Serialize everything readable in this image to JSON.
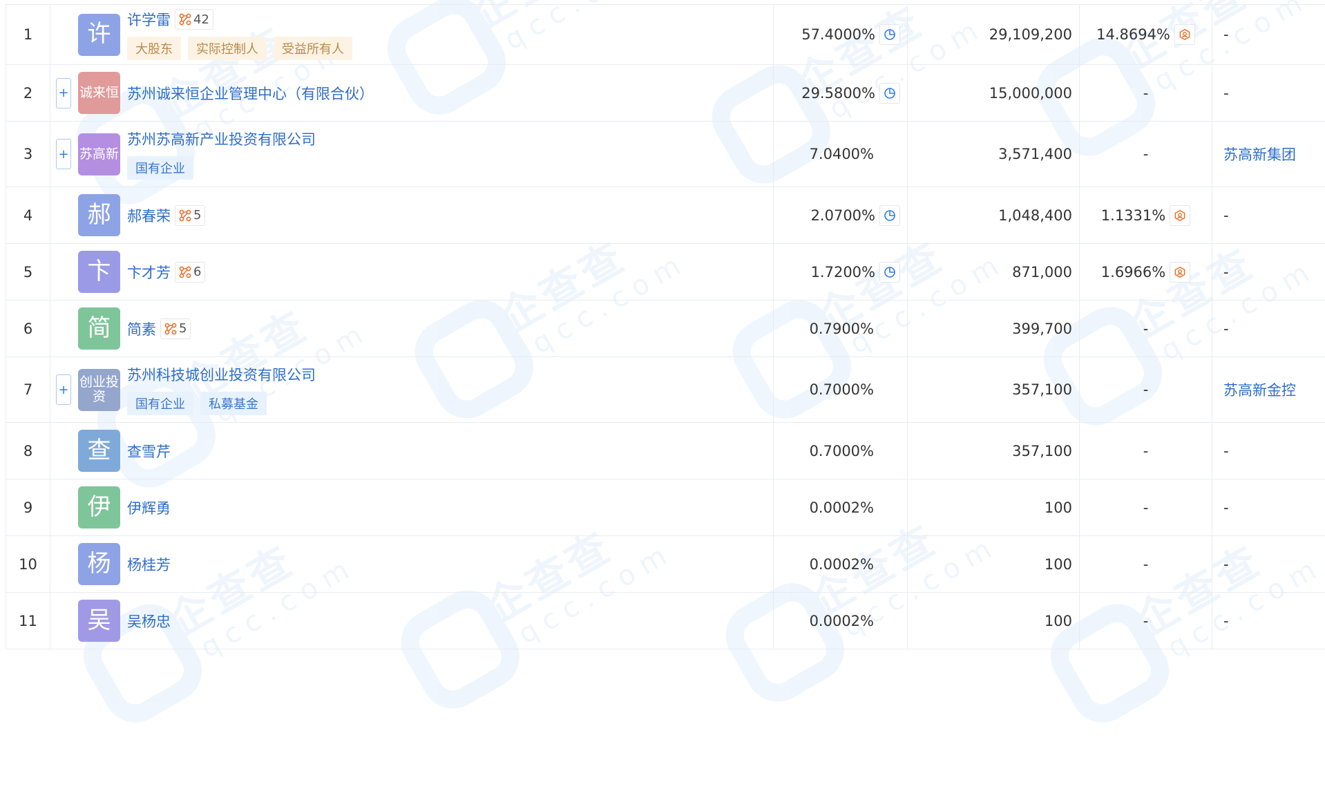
{
  "icons": {
    "relation": "relation-graph-icon",
    "pie": "pie-chart-icon",
    "beneficiary": "beneficiary-icon",
    "expand": "plus-expand-icon"
  },
  "colors": {
    "link": "#2f6ec9",
    "tag_gold_bg": "#fdf3e4",
    "tag_gold_text": "#b8894d",
    "tag_blue_bg": "#e8f2fd",
    "tag_blue_text": "#3977cc",
    "relation_orange": "#e86f2b"
  },
  "watermark": {
    "main": "企查查",
    "sub": "qcc.com"
  },
  "rows": [
    {
      "no": "1",
      "avatar": "许",
      "avatar_color": "#8ea3e6",
      "name": "许学雷",
      "rel_count": "42",
      "tags": [
        "大股东",
        "实际控制人",
        "受益所有人"
      ],
      "tag_style": "gold",
      "pct": "57.4000%",
      "amount": "29,109,200",
      "indirect": "14.8694%",
      "group": "-"
    },
    {
      "no": "2",
      "avatar": "诚来恒",
      "avatar_color": "#e09a9a",
      "expand": "+",
      "name": "苏州诚来恒企业管理中心（有限合伙）",
      "pct": "29.5800%",
      "amount": "15,000,000",
      "indirect": "-",
      "group": "-"
    },
    {
      "no": "3",
      "avatar": "苏高新",
      "avatar_color": "#b48ee0",
      "expand": "+",
      "name": "苏州苏高新产业投资有限公司",
      "tags": [
        "国有企业"
      ],
      "tag_style": "blue",
      "pct": "7.0400%",
      "amount": "3,571,400",
      "indirect": "-",
      "group": "苏高新集团"
    },
    {
      "no": "4",
      "avatar": "郝",
      "avatar_color": "#8ea3e6",
      "name": "郝春荣",
      "rel_count": "5",
      "pct": "2.0700%",
      "amount": "1,048,400",
      "indirect": "1.1331%",
      "group": "-"
    },
    {
      "no": "5",
      "avatar": "卞",
      "avatar_color": "#9a9ae6",
      "name": "卞才芳",
      "rel_count": "6",
      "pct": "1.7200%",
      "amount": "871,000",
      "indirect": "1.6966%",
      "group": "-"
    },
    {
      "no": "6",
      "avatar": "简",
      "avatar_color": "#7fc59a",
      "name": "简素",
      "rel_count": "5",
      "pct": "0.7900%",
      "amount": "399,700",
      "indirect": "-",
      "group": "-"
    },
    {
      "no": "7",
      "avatar": "创业投资",
      "avatar_color": "#95a6cd",
      "expand": "+",
      "name": "苏州科技城创业投资有限公司",
      "tags": [
        "国有企业",
        "私募基金"
      ],
      "tag_style": "blue",
      "pct": "0.7000%",
      "amount": "357,100",
      "indirect": "-",
      "group": "苏高新金控"
    },
    {
      "no": "8",
      "avatar": "查",
      "avatar_color": "#7fa9d8",
      "name": "查雪芹",
      "pct": "0.7000%",
      "amount": "357,100",
      "indirect": "-",
      "group": "-"
    },
    {
      "no": "9",
      "avatar": "伊",
      "avatar_color": "#7fc59a",
      "name": "伊辉勇",
      "pct": "0.0002%",
      "amount": "100",
      "indirect": "-",
      "group": "-"
    },
    {
      "no": "10",
      "avatar": "杨",
      "avatar_color": "#8ea3e6",
      "name": "杨桂芳",
      "pct": "0.0002%",
      "amount": "100",
      "indirect": "-",
      "group": "-"
    },
    {
      "no": "11",
      "avatar": "吴",
      "avatar_color": "#a09ae6",
      "name": "吴杨忠",
      "pct": "0.0002%",
      "amount": "100",
      "indirect": "-",
      "group": "-"
    }
  ]
}
